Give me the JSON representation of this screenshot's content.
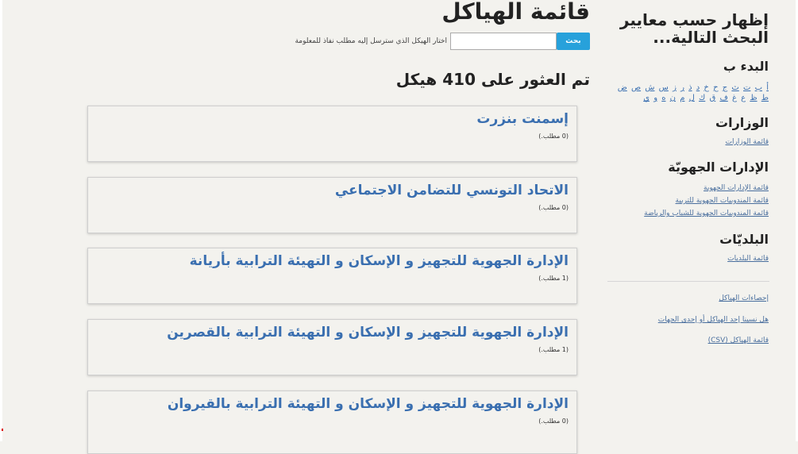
{
  "main": {
    "title": "قائمة الهياكل",
    "search": {
      "label": "اختار الهيكل الذي سترسل إليه مطلب نفاذ للمعلومة",
      "input_value": "",
      "input_placeholder": "",
      "button_label": "بحث"
    },
    "result_count": "تم العثور على 410 هيكل",
    "results": [
      {
        "title": "إسمنت بنزرت",
        "meta": "(0 مطلب.)"
      },
      {
        "title": "الاتحاد التونسي للتضامن الاجتماعي",
        "meta": "(0 مطلب.)"
      },
      {
        "title": "الإدارة الجهوية للتجهيز و الإسكان و التهيئة الترابية بأريانة",
        "meta": "(1 مطلب.)"
      },
      {
        "title": "الإدارة الجهوية للتجهيز و الإسكان و التهيئة الترابية بالقصرين",
        "meta": "(1 مطلب.)"
      },
      {
        "title": "الإدارة الجهوية للتجهيز و الإسكان و التهيئة الترابية بالقيروان",
        "meta": "(0 مطلب.)"
      }
    ]
  },
  "sidebar": {
    "title": "إظهار حسب معايير البحث التالية...",
    "alpha_heading": "البدء ب",
    "letters": [
      "أ",
      "ب",
      "ت",
      "ث",
      "ج",
      "ح",
      "خ",
      "د",
      "ذ",
      "ر",
      "ز",
      "س",
      "ش",
      "ص",
      "ض",
      "ط",
      "ظ",
      "ع",
      "غ",
      "ف",
      "ق",
      "ك",
      "ل",
      "م",
      "ن",
      "ه",
      "و",
      "ي"
    ],
    "ministries": {
      "heading": "الوزارات",
      "links": [
        "قائمة الوزارات"
      ]
    },
    "regional": {
      "heading": "الإدارات الجهويّة",
      "links": [
        "قائمة الإدارات الجهوية",
        "قائمة المندوبيات الجهوية للتربية",
        "قائمة المندوبيات الجهوية للشباب والرياضة"
      ]
    },
    "municipalities": {
      "heading": "البلديّات",
      "links": [
        "قائمة البلديات"
      ]
    },
    "footer_links": [
      "إحصاءات الهياكل",
      "هل نسينا إحد الهياكل أو إحدى الجهات",
      "قائمة الهياكل (CSV)"
    ]
  },
  "colors": {
    "background": "#f3f2ee",
    "link": "#3a6fb0",
    "button": "#27a1db"
  }
}
